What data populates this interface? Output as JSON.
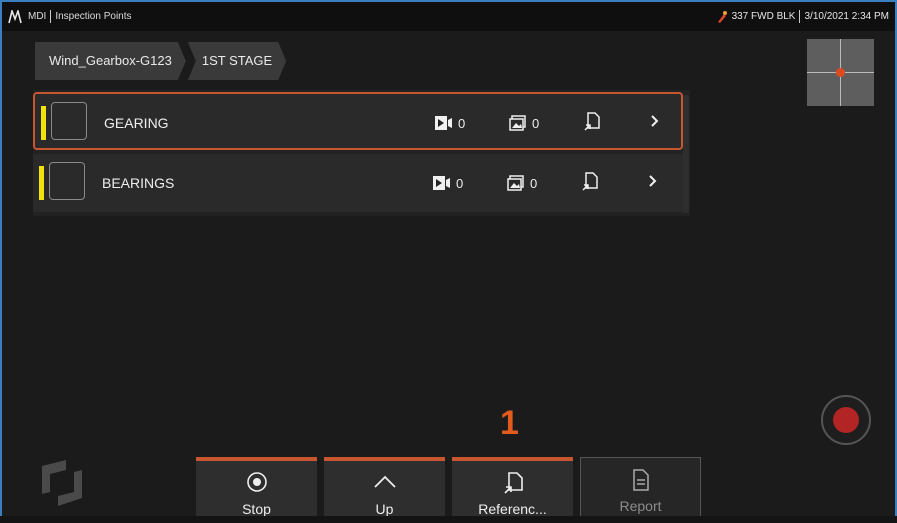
{
  "topbar": {
    "app": "MDI",
    "screen": "Inspection Points",
    "probe": "337 FWD BLK",
    "datetime": "3/10/2021 2:34 PM"
  },
  "breadcrumb": [
    "Wind_Gearbox-G123",
    "1ST STAGE"
  ],
  "rows": [
    {
      "label": "GEARING",
      "videos": "0",
      "images": "0",
      "selected": true,
      "status_color": "#f2e20c"
    },
    {
      "label": "BEARINGS",
      "videos": "0",
      "images": "0",
      "selected": false,
      "status_color": "#f2e20c"
    }
  ],
  "callout": "1",
  "buttons": {
    "stop": "Stop",
    "up": "Up",
    "reference": "Referenc...",
    "report": "Report"
  },
  "colors": {
    "accent": "#c8562e",
    "status": "#f2e20c",
    "record": "#b32424"
  }
}
